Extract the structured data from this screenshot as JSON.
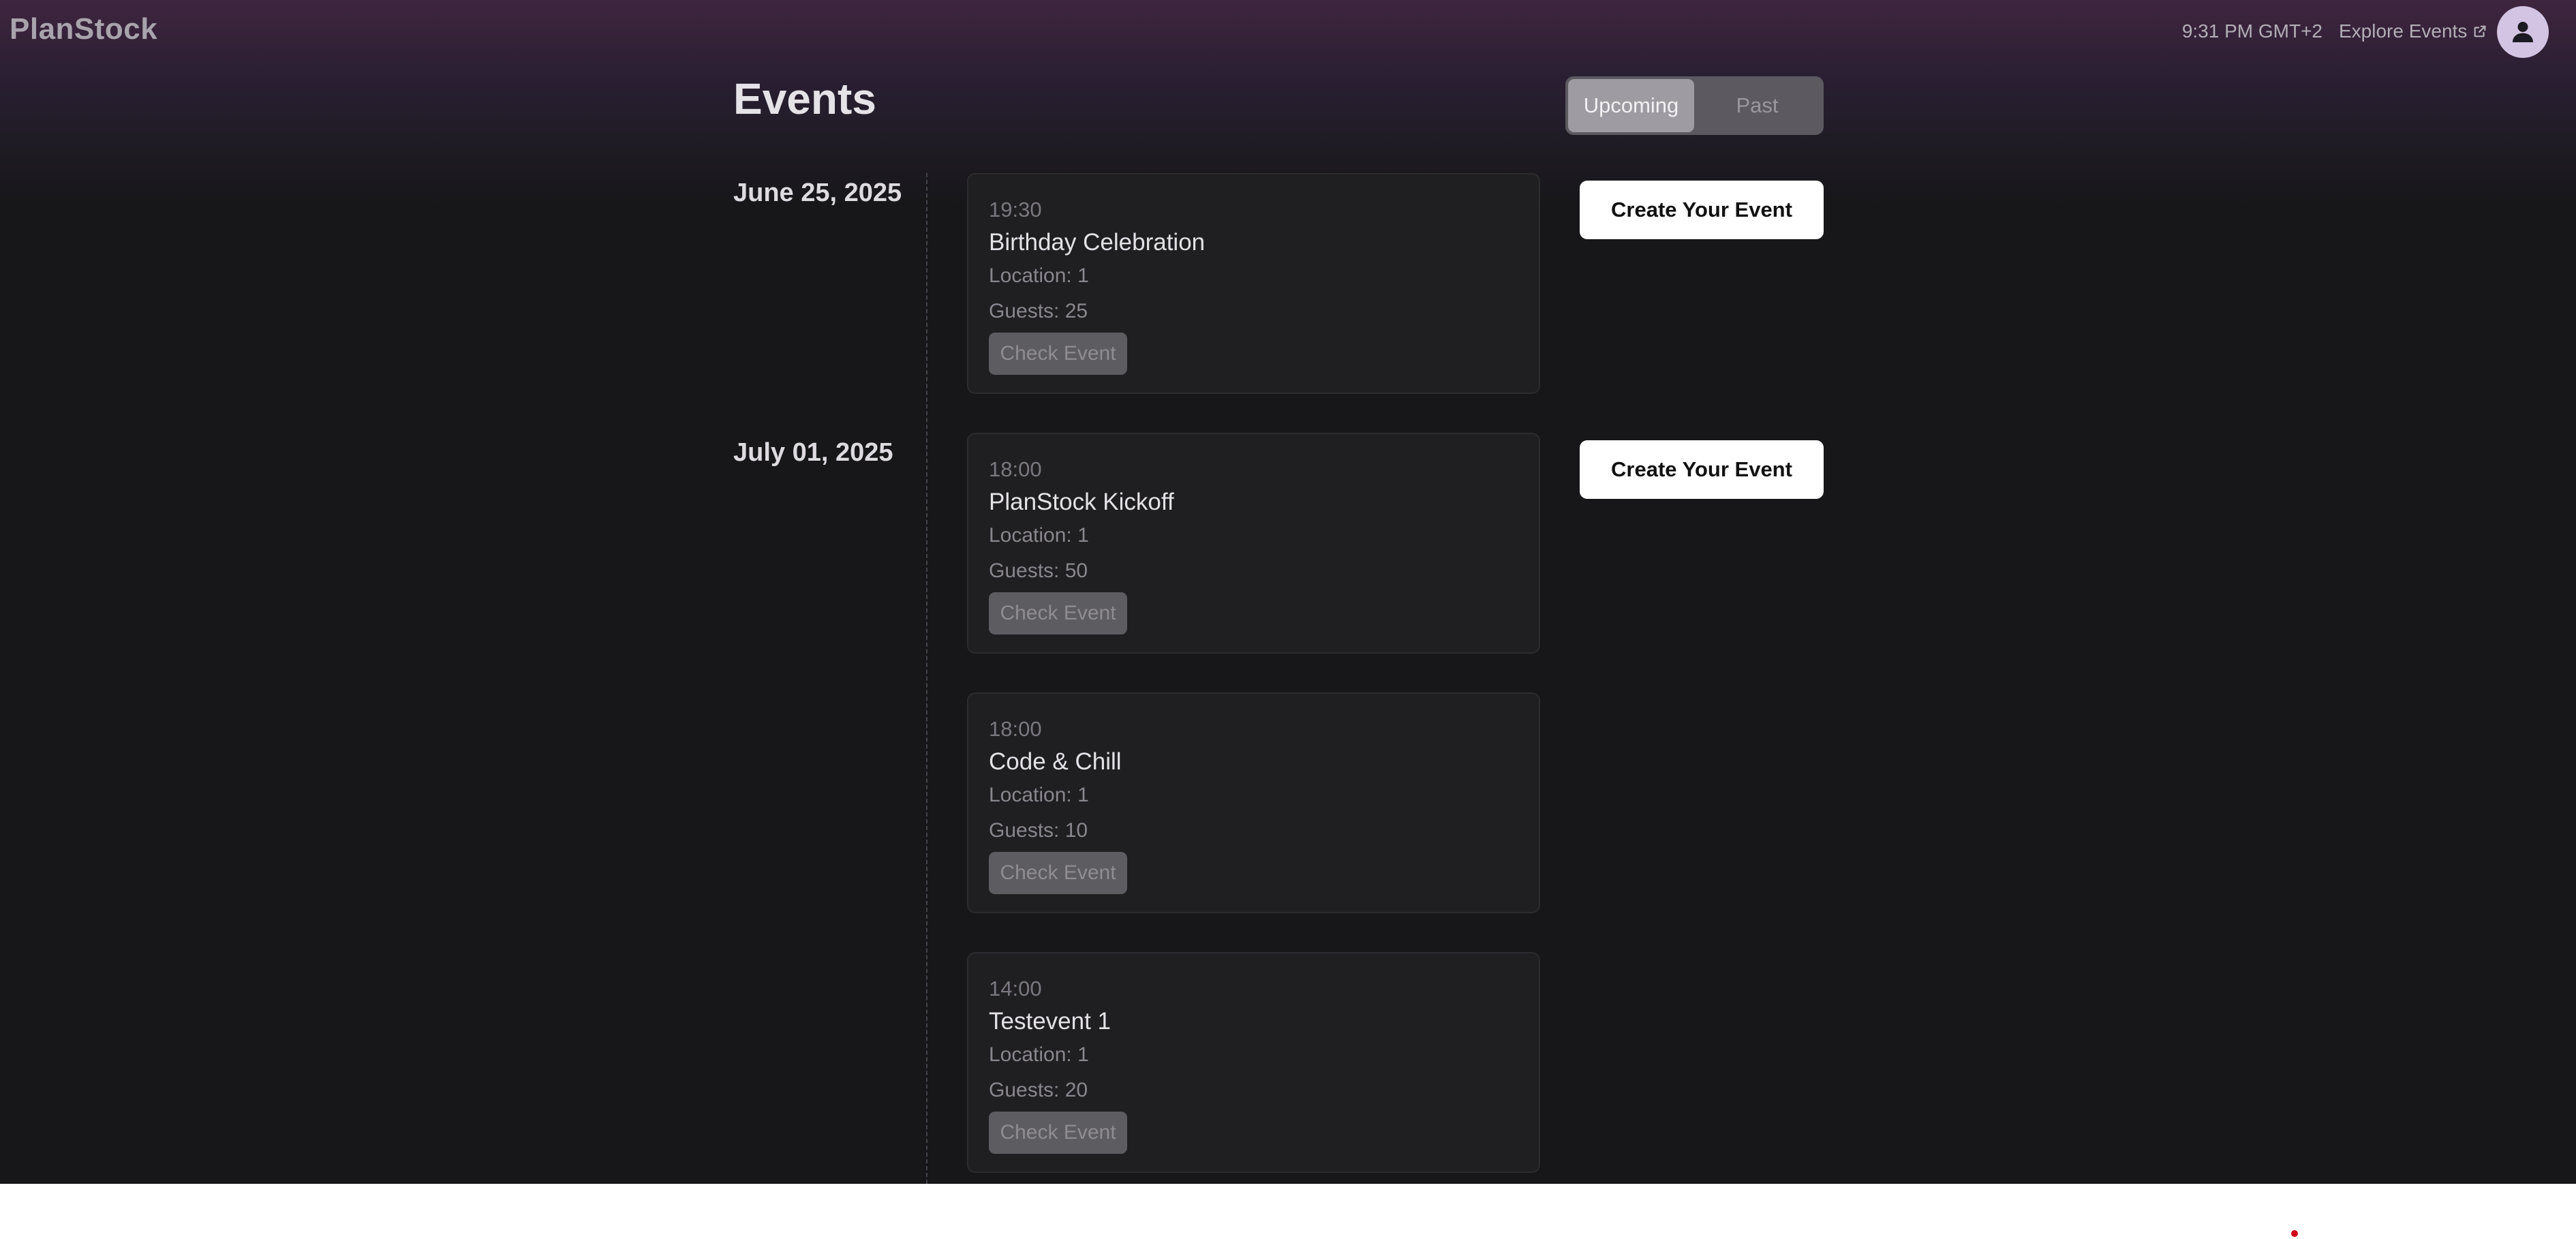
{
  "header": {
    "brand": "PlanStock",
    "clock": "9:31 PM GMT+2",
    "explore_label": "Explore Events"
  },
  "page": {
    "title": "Events",
    "tabs": [
      {
        "label": "Upcoming",
        "active": true
      },
      {
        "label": "Past",
        "active": false
      }
    ]
  },
  "groups": [
    {
      "date": "June 25, 2025",
      "create_label": "Create Your Event",
      "events": [
        {
          "time": "19:30",
          "name": "Birthday Celebration",
          "location": "Location: 1",
          "guests": "Guests: 25",
          "button": "Check Event"
        }
      ]
    },
    {
      "date": "July 01, 2025",
      "create_label": "Create Your Event",
      "events": [
        {
          "time": "18:00",
          "name": "PlanStock Kickoff",
          "location": "Location: 1",
          "guests": "Guests: 50",
          "button": "Check Event"
        },
        {
          "time": "18:00",
          "name": "Code & Chill",
          "location": "Location: 1",
          "guests": "Guests: 10",
          "button": "Check Event"
        },
        {
          "time": "14:00",
          "name": "Testevent 1",
          "location": "Location: 1",
          "guests": "Guests: 20",
          "button": "Check Event"
        }
      ]
    }
  ],
  "colors": {
    "accent_button": "#ffffff",
    "card_background": "#1f1f22",
    "header_gradient_top": "#3f253f",
    "page_background": "#17171a"
  },
  "icons": {
    "explore": "external-link-icon",
    "avatar": "user-icon"
  }
}
